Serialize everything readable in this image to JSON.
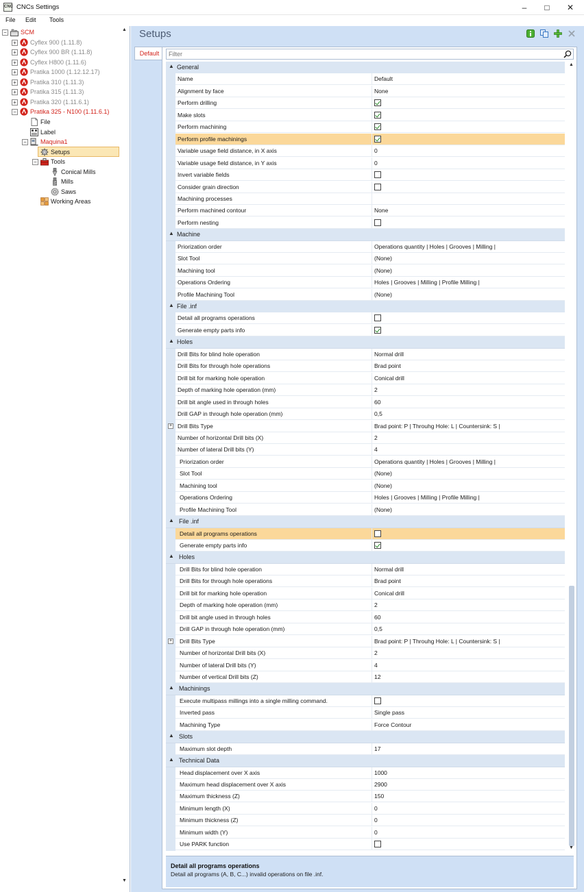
{
  "window": {
    "title": "CNCs Settings",
    "app_icon_text": "CNC"
  },
  "menu": [
    "File",
    "Edit",
    "Tools"
  ],
  "tree": [
    {
      "label": "SCM",
      "style": "red",
      "level": 0,
      "expander": "⊟",
      "icon": "machine-folder-icon"
    },
    {
      "label": "Cyflex 900 (1.11.8)",
      "style": "gray",
      "level": 1,
      "expander": "+",
      "icon": "scm-logo-icon"
    },
    {
      "label": "Cyflex 900 BR (1.11.8)",
      "style": "gray",
      "level": 1,
      "expander": "+",
      "icon": "scm-logo-icon"
    },
    {
      "label": "Cyflex H800 (1.11.6)",
      "style": "gray",
      "level": 1,
      "expander": "+",
      "icon": "scm-logo-icon"
    },
    {
      "label": "Pratika 1000 (1.12.12.17)",
      "style": "gray",
      "level": 1,
      "expander": "+",
      "icon": "scm-logo-icon"
    },
    {
      "label": "Pratika 310 (1.11.3)",
      "style": "gray",
      "level": 1,
      "expander": "+",
      "icon": "scm-logo-icon"
    },
    {
      "label": "Pratika 315 (1.11.3)",
      "style": "gray",
      "level": 1,
      "expander": "+",
      "icon": "scm-logo-icon"
    },
    {
      "label": "Pratika 320 (1.11.6.1)",
      "style": "gray",
      "level": 1,
      "expander": "+",
      "icon": "scm-logo-icon"
    },
    {
      "label": "Pratika 325 - N100 (1.11.6.1)",
      "style": "red",
      "level": 1,
      "expander": "−",
      "icon": "scm-logo-icon"
    },
    {
      "label": "File",
      "style": "",
      "level": 2,
      "expander": "",
      "icon": "file-icon"
    },
    {
      "label": "Label",
      "style": "",
      "level": 2,
      "expander": "",
      "icon": "label-icon"
    },
    {
      "label": "Maquina1",
      "style": "red",
      "level": 2,
      "expander": "−",
      "icon": "machine-icon"
    },
    {
      "label": "Setups",
      "style": "",
      "level": 3,
      "expander": "",
      "icon": "gear-icon",
      "selected": true
    },
    {
      "label": "Tools",
      "style": "",
      "level": 3,
      "expander": "−",
      "icon": "toolbox-icon"
    },
    {
      "label": "Conical Mills",
      "style": "",
      "level": 4,
      "expander": "",
      "icon": "conical-mill-icon"
    },
    {
      "label": "Mills",
      "style": "",
      "level": 4,
      "expander": "",
      "icon": "mill-icon"
    },
    {
      "label": "Saws",
      "style": "",
      "level": 4,
      "expander": "",
      "icon": "saw-icon"
    },
    {
      "label": "Working Areas",
      "style": "",
      "level": 3,
      "expander": "",
      "icon": "working-areas-icon"
    }
  ],
  "setups": {
    "header": "Setups",
    "tab_label": "Default",
    "filter_placeholder": "Filter",
    "toolbar_icons": [
      "info-icon",
      "copy-icon",
      "add-icon",
      "delete-icon"
    ]
  },
  "grid": [
    {
      "type": "cat",
      "label": "General",
      "indent": 0
    },
    {
      "name": "Name",
      "value": "Default",
      "indent": 0
    },
    {
      "name": "Alignment by face",
      "value": "None",
      "indent": 0
    },
    {
      "name": "Perform drilling",
      "check": true,
      "indent": 0
    },
    {
      "name": "Make slots",
      "check": true,
      "indent": 0
    },
    {
      "name": "Perform machining",
      "check": true,
      "indent": 0
    },
    {
      "name": "Perform profile machinings",
      "check": true,
      "indent": 0,
      "highlight": true
    },
    {
      "name": "Variable usage field distance, in X axis",
      "value": "0",
      "indent": 0
    },
    {
      "name": "Variable usage field distance, in Y axis",
      "value": "0",
      "indent": 0
    },
    {
      "name": "Invert variable fields",
      "check": false,
      "indent": 0
    },
    {
      "name": "Consider grain direction",
      "check": false,
      "indent": 0
    },
    {
      "name": "Machining processes",
      "value": "",
      "indent": 0
    },
    {
      "name": "Perform machined contour",
      "value": "None",
      "indent": 0
    },
    {
      "name": "Perform nesting",
      "check": false,
      "indent": 0
    },
    {
      "type": "cat",
      "label": "Machine",
      "indent": 0
    },
    {
      "name": "Priorization order",
      "value": "Operations quantity | Holes | Grooves | Milling |",
      "indent": 0
    },
    {
      "name": "Slot Tool",
      "value": "(None)",
      "indent": 0
    },
    {
      "name": "Machining tool",
      "value": "(None)",
      "indent": 0
    },
    {
      "name": "Operations Ordering",
      "value": "Holes | Grooves | Milling | Profile Milling |",
      "indent": 0
    },
    {
      "name": "Profile Machining Tool",
      "value": "(None)",
      "indent": 0
    },
    {
      "type": "cat",
      "label": "File .inf",
      "indent": 0
    },
    {
      "name": "Detail all programs operations",
      "check": false,
      "indent": 0
    },
    {
      "name": "Generate empty parts info",
      "check": true,
      "indent": 0
    },
    {
      "type": "cat",
      "label": "Holes",
      "indent": 0
    },
    {
      "name": "Drill Bits for blind hole operation",
      "value": "Normal drill",
      "indent": 0
    },
    {
      "name": "Drill Bits for through hole operations",
      "value": "Brad point",
      "indent": 0
    },
    {
      "name": "Drill bit for marking hole operation",
      "value": "Conical drill",
      "indent": 0
    },
    {
      "name": "Depth of marking hole operation (mm)",
      "value": "2",
      "indent": 0
    },
    {
      "name": "Drill bit angle used in through holes",
      "value": "60",
      "indent": 0
    },
    {
      "name": "Drill GAP in through hole operation (mm)",
      "value": "0,5",
      "indent": 0
    },
    {
      "name": "Drill Bits Type",
      "value": "Brad point: P  |  Throuhg Hole: L  |  Countersink: S  |",
      "indent": 0,
      "plus": true
    },
    {
      "name": "Number of horizontal Drill bits (X)",
      "value": "2",
      "indent": 0
    },
    {
      "name": "Number of lateral Drill bits (Y)",
      "value": "4",
      "indent": 0
    },
    {
      "name": "Priorization order",
      "value": "Operations quantity | Holes | Grooves | Milling |",
      "indent": 1
    },
    {
      "name": "Slot Tool",
      "value": "(None)",
      "indent": 1
    },
    {
      "name": "Machining tool",
      "value": "(None)",
      "indent": 1
    },
    {
      "name": "Operations Ordering",
      "value": "Holes | Grooves | Milling | Profile Milling |",
      "indent": 1
    },
    {
      "name": "Profile Machining Tool",
      "value": "(None)",
      "indent": 1
    },
    {
      "type": "cat",
      "label": "File .inf",
      "indent": 1
    },
    {
      "name": "Detail all programs operations",
      "check": false,
      "indent": 1,
      "highlight": true
    },
    {
      "name": "Generate empty parts info",
      "check": true,
      "indent": 1
    },
    {
      "type": "cat",
      "label": "Holes",
      "indent": 1
    },
    {
      "name": "Drill Bits for blind hole operation",
      "value": "Normal drill",
      "indent": 1
    },
    {
      "name": "Drill Bits for through hole operations",
      "value": "Brad point",
      "indent": 1
    },
    {
      "name": "Drill bit for marking hole operation",
      "value": "Conical drill",
      "indent": 1
    },
    {
      "name": "Depth of marking hole operation (mm)",
      "value": "2",
      "indent": 1
    },
    {
      "name": "Drill bit angle used in through holes",
      "value": "60",
      "indent": 1
    },
    {
      "name": "Drill GAP in through hole operation (mm)",
      "value": "0,5",
      "indent": 1
    },
    {
      "name": "Drill Bits Type",
      "value": "Brad point: P  |  Throuhg Hole: L  |  Countersink: S  |",
      "indent": 1,
      "plus": true
    },
    {
      "name": "Number of horizontal Drill bits (X)",
      "value": "2",
      "indent": 1
    },
    {
      "name": "Number of lateral Drill bits (Y)",
      "value": "4",
      "indent": 1
    },
    {
      "name": "Number of vertical Drill bits (Z)",
      "value": "12",
      "indent": 1
    },
    {
      "type": "cat",
      "label": "Machinings",
      "indent": 1
    },
    {
      "name": "Execute multipass millings into a single milling command.",
      "check": false,
      "indent": 1
    },
    {
      "name": "Inverted pass",
      "value": "Single pass",
      "indent": 1
    },
    {
      "name": "Machining Type",
      "value": "Force Contour",
      "indent": 1
    },
    {
      "type": "cat",
      "label": "Slots",
      "indent": 1
    },
    {
      "name": "Maximum slot depth",
      "value": "17",
      "indent": 1
    },
    {
      "type": "cat",
      "label": "Technical Data",
      "indent": 1
    },
    {
      "name": "Head displacement over X axis",
      "value": "1000",
      "indent": 1
    },
    {
      "name": "Maximum head displacement over X axis",
      "value": "2900",
      "indent": 1
    },
    {
      "name": "Maximum thickness (Z)",
      "value": "150",
      "indent": 1
    },
    {
      "name": "Minimum length (X)",
      "value": "0",
      "indent": 1
    },
    {
      "name": "Minimum thickness (Z)",
      "value": "0",
      "indent": 1
    },
    {
      "name": "Minimum width (Y)",
      "value": "0",
      "indent": 1
    },
    {
      "name": "Use PARK function",
      "check": false,
      "indent": 1
    }
  ],
  "description": {
    "title": "Detail all programs operations",
    "text": "Detail all programs (A, B, C...) invalid operations on file .inf."
  }
}
